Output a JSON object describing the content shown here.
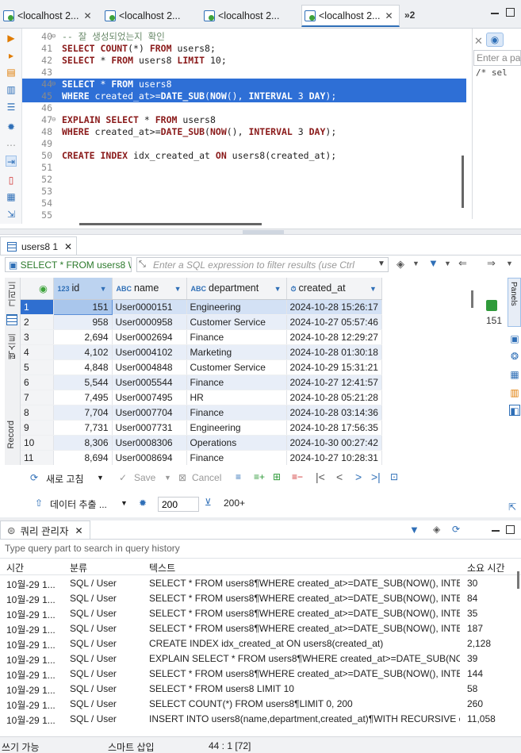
{
  "tabs": [
    {
      "label": "<localhost 2..."
    },
    {
      "label": "<localhost 2..."
    },
    {
      "label": "<localhost 2..."
    },
    {
      "label": "<localhost 2..."
    }
  ],
  "tab_overflow": "»2",
  "editor": {
    "lines": [
      {
        "num": "40",
        "fold": "⊖",
        "text": "-- 잘 생성되었는지 확인",
        "kind": "comment"
      },
      {
        "num": "41",
        "fold": "",
        "text": "SELECT COUNT(*) FROM users8;",
        "kind": "code"
      },
      {
        "num": "42",
        "fold": "",
        "text": "SELECT * FROM users8 LIMIT 10;",
        "kind": "code"
      },
      {
        "num": "43",
        "fold": "",
        "text": "",
        "kind": "code"
      },
      {
        "num": "44",
        "fold": "⊖",
        "text": "SELECT * FROM users8",
        "kind": "selected"
      },
      {
        "num": "45",
        "fold": "",
        "text": "WHERE created_at>=DATE_SUB(NOW(), INTERVAL 3 DAY);",
        "kind": "selected"
      },
      {
        "num": "46",
        "fold": "",
        "text": "",
        "kind": "code"
      },
      {
        "num": "47",
        "fold": "⊖",
        "text": "EXPLAIN SELECT * FROM users8",
        "kind": "code"
      },
      {
        "num": "48",
        "fold": "",
        "text": "WHERE created_at>=DATE_SUB(NOW(), INTERVAL 3 DAY);",
        "kind": "code"
      },
      {
        "num": "49",
        "fold": "",
        "text": "",
        "kind": "code"
      },
      {
        "num": "50",
        "fold": "",
        "text": "CREATE INDEX idx_created_at ON users8(created_at);",
        "kind": "code"
      },
      {
        "num": "51",
        "fold": "",
        "text": "",
        "kind": "code"
      },
      {
        "num": "52",
        "fold": "",
        "text": "",
        "kind": "code"
      },
      {
        "num": "53",
        "fold": "",
        "text": "",
        "kind": "code"
      },
      {
        "num": "54",
        "fold": "",
        "text": "",
        "kind": "code"
      },
      {
        "num": "55",
        "fold": "",
        "text": "",
        "kind": "code"
      }
    ]
  },
  "outline": {
    "filter_placeholder": "Enter a par",
    "text": "/* sel"
  },
  "results": {
    "tab_label": "users8 1",
    "query_text": "SELECT * FROM users8 W",
    "filter_placeholder": "Enter a SQL expression to filter results (use Ctrl",
    "side_tabs": {
      "grid": "그리드",
      "text": "텍스트",
      "record": "Record"
    },
    "columns": [
      {
        "type": "123",
        "name": "id"
      },
      {
        "type": "ABC",
        "name": "name"
      },
      {
        "type": "ABC",
        "name": "department"
      },
      {
        "type": "⏱",
        "name": "created_at"
      }
    ],
    "rows": [
      {
        "rn": "1",
        "id": "151",
        "name": "User0000151",
        "department": "Engineering",
        "created_at": "2024-10-28 15:26:17"
      },
      {
        "rn": "2",
        "id": "958",
        "name": "User0000958",
        "department": "Customer Service",
        "created_at": "2024-10-27 05:57:46"
      },
      {
        "rn": "3",
        "id": "2,694",
        "name": "User0002694",
        "department": "Finance",
        "created_at": "2024-10-28 12:29:27"
      },
      {
        "rn": "4",
        "id": "4,102",
        "name": "User0004102",
        "department": "Marketing",
        "created_at": "2024-10-28 01:30:18"
      },
      {
        "rn": "5",
        "id": "4,848",
        "name": "User0004848",
        "department": "Customer Service",
        "created_at": "2024-10-29 15:31:21"
      },
      {
        "rn": "6",
        "id": "5,544",
        "name": "User0005544",
        "department": "Finance",
        "created_at": "2024-10-27 12:41:57"
      },
      {
        "rn": "7",
        "id": "7,495",
        "name": "User0007495",
        "department": "HR",
        "created_at": "2024-10-28 05:21:28"
      },
      {
        "rn": "8",
        "id": "7,704",
        "name": "User0007704",
        "department": "Finance",
        "created_at": "2024-10-28 03:14:36"
      },
      {
        "rn": "9",
        "id": "7,731",
        "name": "User0007731",
        "department": "Engineering",
        "created_at": "2024-10-28 17:56:35"
      },
      {
        "rn": "10",
        "id": "8,306",
        "name": "User0008306",
        "department": "Operations",
        "created_at": "2024-10-30 00:27:42"
      },
      {
        "rn": "11",
        "id": "8,694",
        "name": "User0008694",
        "department": "Finance",
        "created_at": "2024-10-27 10:28:31"
      }
    ],
    "row_count": "151",
    "panels_label": "Panels",
    "toolbar": {
      "refresh": "새로 고침",
      "save": "Save",
      "cancel": "Cancel",
      "export": "데이터 추출 ...",
      "limit_value": "200",
      "fetch_more": "200+"
    }
  },
  "query_manager": {
    "tab_label": "쿼리 관리자",
    "search_placeholder": "Type query part to search in query history",
    "headers": {
      "time": "시간",
      "type": "분류",
      "text": "텍스트",
      "duration": "소요 시간"
    },
    "rows": [
      {
        "time": "10월-29 1...",
        "type": "SQL / User",
        "text": "SELECT * FROM users8¶WHERE created_at>=DATE_SUB(NOW(), INTER...",
        "duration": "30"
      },
      {
        "time": "10월-29 1...",
        "type": "SQL / User",
        "text": "SELECT * FROM users8¶WHERE created_at>=DATE_SUB(NOW(), INTER...",
        "duration": "84"
      },
      {
        "time": "10월-29 1...",
        "type": "SQL / User",
        "text": "SELECT * FROM users8¶WHERE created_at>=DATE_SUB(NOW(), INTER...",
        "duration": "35"
      },
      {
        "time": "10월-29 1...",
        "type": "SQL / User",
        "text": "SELECT * FROM users8¶WHERE created_at>=DATE_SUB(NOW(), INTER...",
        "duration": "187"
      },
      {
        "time": "10월-29 1...",
        "type": "SQL / User",
        "text": "CREATE INDEX idx_created_at ON users8(created_at)",
        "duration": "2,128"
      },
      {
        "time": "10월-29 1...",
        "type": "SQL / User",
        "text": "EXPLAIN SELECT * FROM users8¶WHERE created_at>=DATE_SUB(NO...",
        "duration": "39"
      },
      {
        "time": "10월-29 1...",
        "type": "SQL / User",
        "text": "SELECT * FROM users8¶WHERE created_at>=DATE_SUB(NOW(), INTER...",
        "duration": "144"
      },
      {
        "time": "10월-29 1...",
        "type": "SQL / User",
        "text": "SELECT * FROM users8 LIMIT 10",
        "duration": "58"
      },
      {
        "time": "10월-29 1...",
        "type": "SQL / User",
        "text": "SELECT COUNT(*) FROM users8¶LIMIT 0, 200",
        "duration": "260"
      },
      {
        "time": "10월-29 1...",
        "type": "SQL / User",
        "text": "INSERT INTO users8(name,department,created_at)¶WITH RECURSIVE c...",
        "duration": "11,058"
      }
    ]
  },
  "status": {
    "write_mode": "쓰기 가능",
    "insert_mode": "스마트 삽입",
    "position": "44 : 1 [72]"
  },
  "colors": {
    "accent": "#2f6fb7",
    "selection": "#2e6fd6",
    "keyword": "#8a1a1a",
    "alt_row": "#e8eef8"
  }
}
